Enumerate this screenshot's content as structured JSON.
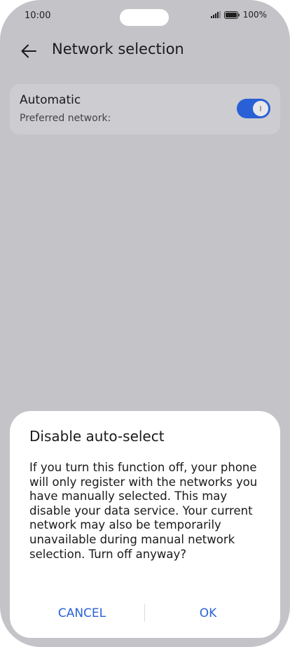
{
  "status_bar": {
    "time": "10:00",
    "battery": "100%",
    "icons": [
      "signal-icon",
      "battery-icon"
    ]
  },
  "header": {
    "back_icon": "arrow-left-icon",
    "title": "Network selection"
  },
  "setting": {
    "title": "Automatic",
    "subtitle": "Preferred network:",
    "toggle_on": true,
    "accent_color": "#2960d6"
  },
  "dialog": {
    "title": "Disable auto-select",
    "message": "If you turn this function off, your phone will only register with the networks you have manually selected. This may disable your data service. Your current network may also be temporarily unavailable during manual network selection. Turn off anyway?",
    "cancel_label": "CANCEL",
    "ok_label": "OK",
    "button_color": "#2a62d6"
  },
  "colors": {
    "scrim_background": "#c4c3c8",
    "card_background": "#cdccd1",
    "dialog_background": "#ffffff"
  }
}
